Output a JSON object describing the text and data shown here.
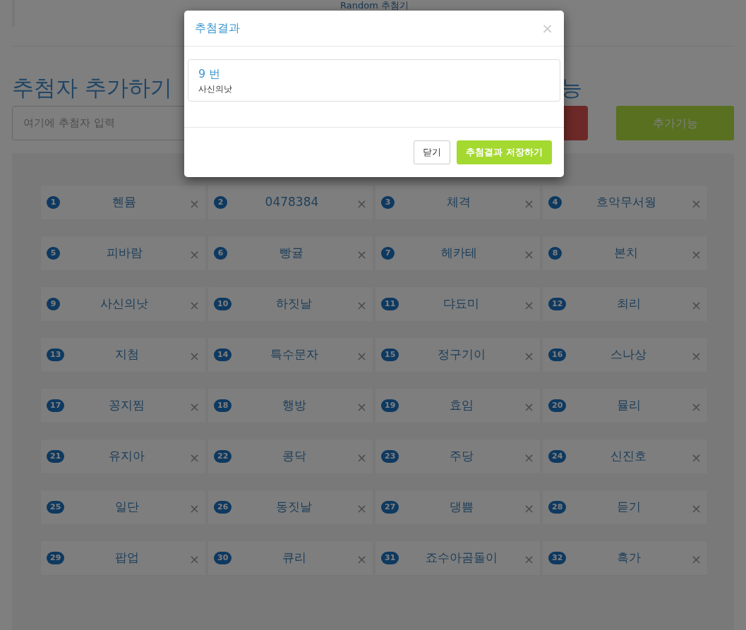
{
  "page_title": "Random 추첨기",
  "add_section": {
    "heading": "추첨자 추가하기",
    "placeholder": "여기에 추첨자 입력"
  },
  "extra_section": {
    "heading_visible": "능",
    "button": "추가기능"
  },
  "entries": [
    {
      "number": "1",
      "name": "혠뮴"
    },
    {
      "number": "2",
      "name": "0478384"
    },
    {
      "number": "3",
      "name": "체격"
    },
    {
      "number": "4",
      "name": "흐악무서웡"
    },
    {
      "number": "5",
      "name": "피바람"
    },
    {
      "number": "6",
      "name": "빵귤"
    },
    {
      "number": "7",
      "name": "헤카테"
    },
    {
      "number": "8",
      "name": "본치"
    },
    {
      "number": "9",
      "name": "사신의낫"
    },
    {
      "number": "10",
      "name": "하짓날"
    },
    {
      "number": "11",
      "name": "댜됴미"
    },
    {
      "number": "12",
      "name": "최리"
    },
    {
      "number": "13",
      "name": "지첨"
    },
    {
      "number": "14",
      "name": "특수문자"
    },
    {
      "number": "15",
      "name": "정구기이"
    },
    {
      "number": "16",
      "name": "스나상"
    },
    {
      "number": "17",
      "name": "꽁지찜"
    },
    {
      "number": "18",
      "name": "행방"
    },
    {
      "number": "19",
      "name": "효임"
    },
    {
      "number": "20",
      "name": "뮬리"
    },
    {
      "number": "21",
      "name": "유지아"
    },
    {
      "number": "22",
      "name": "콩닥"
    },
    {
      "number": "23",
      "name": "주당"
    },
    {
      "number": "24",
      "name": "신진호"
    },
    {
      "number": "25",
      "name": "일단"
    },
    {
      "number": "26",
      "name": "동짓날"
    },
    {
      "number": "27",
      "name": "댕쁨"
    },
    {
      "number": "28",
      "name": "듣기"
    },
    {
      "number": "29",
      "name": "팝업"
    },
    {
      "number": "30",
      "name": "큐리"
    },
    {
      "number": "31",
      "name": "죠수아곰돌이"
    },
    {
      "number": "32",
      "name": "흑가"
    }
  ],
  "remove_mark": "×",
  "modal": {
    "title": "추첨결과",
    "close": "×",
    "result": {
      "number": "9 번",
      "name": "사신의낫"
    },
    "buttons": [
      {
        "label": "닫기",
        "kind": "default"
      },
      {
        "label": "추첨결과 저장하기",
        "kind": "primary"
      }
    ]
  }
}
